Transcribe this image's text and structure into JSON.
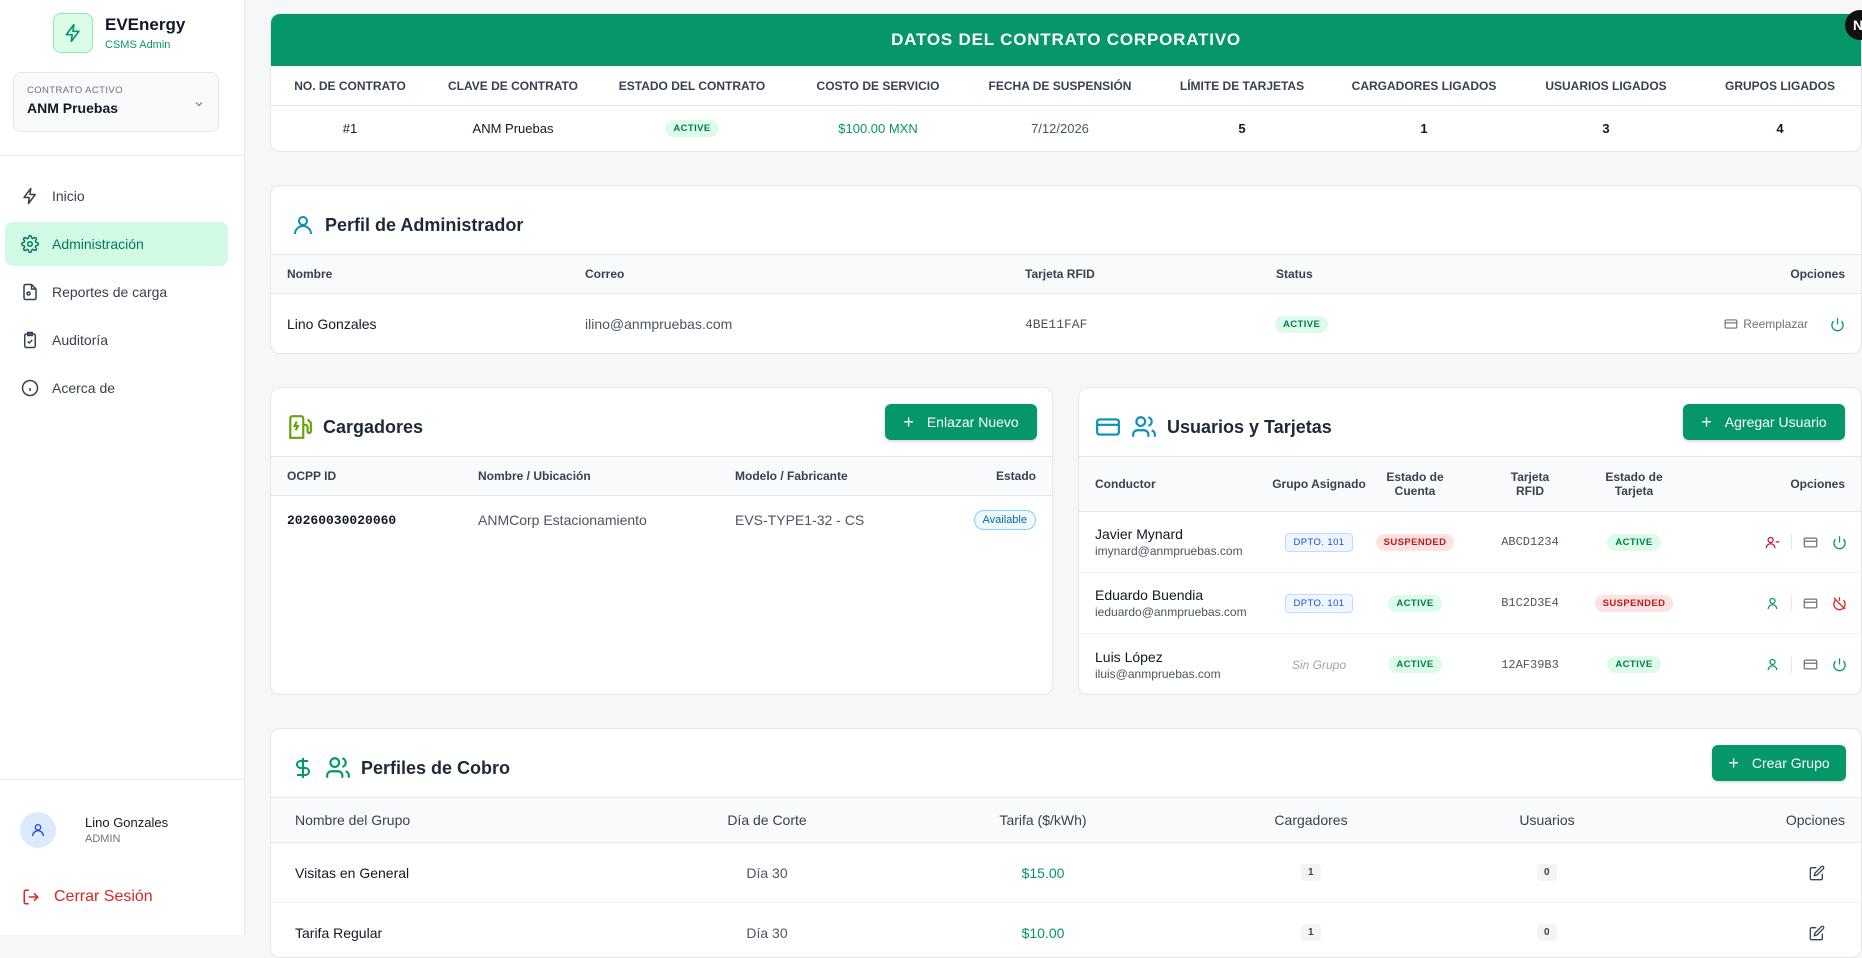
{
  "brand": {
    "name": "EVEnergy",
    "subtitle": "CSMS Admin",
    "icon": "lightning-icon"
  },
  "contract_selector": {
    "label": "CONTRATO ACTIVO",
    "value": "ANM Pruebas"
  },
  "nav": [
    {
      "label": "Inicio",
      "icon": "lightning-icon",
      "active": false
    },
    {
      "label": "Administración",
      "icon": "gear-icon",
      "active": true
    },
    {
      "label": "Reportes de carga",
      "icon": "document-icon",
      "active": false
    },
    {
      "label": "Auditoría",
      "icon": "clipboard-check-icon",
      "active": false
    },
    {
      "label": "Acerca de",
      "icon": "info-icon",
      "active": false
    }
  ],
  "user": {
    "name": "Lino Gonzales",
    "role": "ADMIN"
  },
  "logout_label": "Cerrar Sesión",
  "avatar_initial": "N",
  "contract": {
    "title": "DATOS DEL CONTRATO CORPORATIVO",
    "headers": [
      "NO. DE CONTRATO",
      "CLAVE DE CONTRATO",
      "ESTADO DEL CONTRATO",
      "COSTO DE SERVICIO",
      "FECHA DE SUSPENSIÓN",
      "LÍMITE DE TARJETAS",
      "CARGADORES LIGADOS",
      "USUARIOS LIGADOS",
      "GRUPOS LIGADOS"
    ],
    "values": {
      "number": "#1",
      "key": "ANM Pruebas",
      "status": "ACTIVE",
      "cost": "$100.00 MXN",
      "suspension_date": "7/12/2026",
      "card_limit": "5",
      "chargers": "1",
      "users": "3",
      "groups": "4"
    }
  },
  "admin_profile": {
    "title": "Perfil de Administrador",
    "headers": {
      "name": "Nombre",
      "email": "Correo",
      "rfid": "Tarjeta RFID",
      "status": "Status",
      "options": "Opciones"
    },
    "row": {
      "name": "Lino Gonzales",
      "email": "ilino@anmpruebas.com",
      "rfid": "4BE11FAF",
      "status": "ACTIVE",
      "replace_label": "Reemplazar"
    }
  },
  "chargers": {
    "title": "Cargadores",
    "button": "Enlazar Nuevo",
    "headers": {
      "ocpp": "OCPP ID",
      "name": "Nombre / Ubicación",
      "model": "Modelo / Fabricante",
      "status": "Estado"
    },
    "rows": [
      {
        "ocpp": "20260030020060",
        "name": "ANMCorp Estacionamiento",
        "model": "EVS-TYPE1-32 - CS",
        "status": "Available"
      }
    ]
  },
  "users_cards": {
    "title": "Usuarios y Tarjetas",
    "button": "Agregar Usuario",
    "headers": {
      "driver": "Conductor",
      "group": "Grupo Asignado",
      "account": "Estado de Cuenta",
      "rfid": "Tarjeta RFID",
      "card_status": "Estado de Tarjeta",
      "options": "Opciones"
    },
    "rows": [
      {
        "name": "Javier Mynard",
        "email": "imynard@anmpruebas.com",
        "group": "DPTO. 101",
        "account": "SUSPENDED",
        "rfid": "ABCD1234",
        "card_status": "ACTIVE"
      },
      {
        "name": "Eduardo Buendia",
        "email": "ieduardo@anmpruebas.com",
        "group": "DPTO. 101",
        "account": "ACTIVE",
        "rfid": "B1C2D3E4",
        "card_status": "SUSPENDED"
      },
      {
        "name": "Luis López",
        "email": "iluis@anmpruebas.com",
        "group": "Sin Grupo",
        "account": "ACTIVE",
        "rfid": "12AF39B3",
        "card_status": "ACTIVE"
      }
    ]
  },
  "billing": {
    "title": "Perfiles de Cobro",
    "button": "Crear Grupo",
    "headers": {
      "group": "Nombre del Grupo",
      "cut_day": "Día de Corte",
      "rate": "Tarifa ($/kWh)",
      "chargers": "Cargadores",
      "users": "Usuarios",
      "options": "Opciones"
    },
    "rows": [
      {
        "group": "Visitas en General",
        "cut_day": "Día 30",
        "rate": "$15.00",
        "chargers": "1",
        "users": "0"
      },
      {
        "group": "Tarifa Regular",
        "cut_day": "Día 30",
        "rate": "$10.00",
        "chargers": "1",
        "users": "0"
      }
    ]
  },
  "colors": {
    "primary": "#059669",
    "active_bg": "#d1fae5",
    "danger": "#dc2626"
  }
}
